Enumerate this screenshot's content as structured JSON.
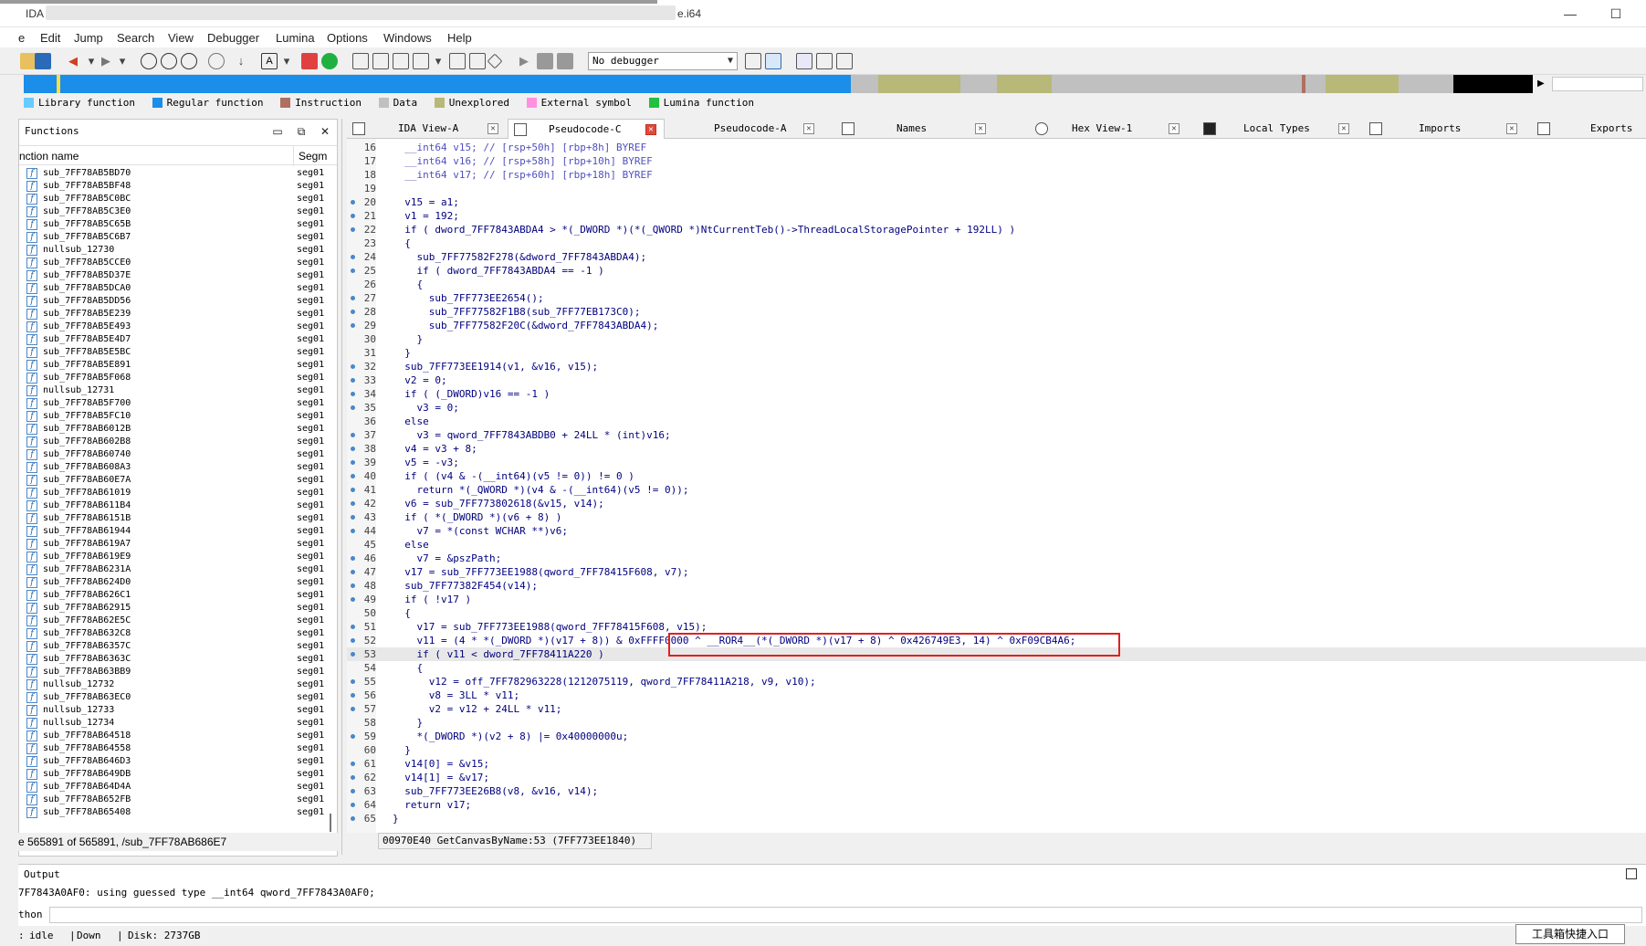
{
  "window": {
    "title_prefix": "IDA -",
    "title_suffix": "e.i64",
    "minimize": "—",
    "maximize": "☐"
  },
  "menu": [
    "e",
    "Edit",
    "Jump",
    "Search",
    "View",
    "Debugger",
    "Lumina",
    "Options",
    "Windows",
    "Help"
  ],
  "toolbar": {
    "debugger_select": "No debugger"
  },
  "legend": [
    {
      "label": "Library function",
      "color": "#66ccff"
    },
    {
      "label": "Regular function",
      "color": "#1a8ee8"
    },
    {
      "label": "Instruction",
      "color": "#b07060"
    },
    {
      "label": "Data",
      "color": "#c0c0c0"
    },
    {
      "label": "Unexplored",
      "color": "#b8b878"
    },
    {
      "label": "External symbol",
      "color": "#ff90e0"
    },
    {
      "label": "Lumina function",
      "color": "#20c040"
    }
  ],
  "functions_panel": {
    "title": "Functions",
    "col_name": "nction name",
    "col_seg": "Segm",
    "items": [
      {
        "name": "sub_7FF78AB5BD70",
        "seg": "seg01"
      },
      {
        "name": "sub_7FF78AB5BF48",
        "seg": "seg01"
      },
      {
        "name": "sub_7FF78AB5C0BC",
        "seg": "seg01"
      },
      {
        "name": "sub_7FF78AB5C3E0",
        "seg": "seg01"
      },
      {
        "name": "sub_7FF78AB5C65B",
        "seg": "seg01"
      },
      {
        "name": "sub_7FF78AB5C6B7",
        "seg": "seg01"
      },
      {
        "name": "nullsub_12730",
        "seg": "seg01"
      },
      {
        "name": "sub_7FF78AB5CCE0",
        "seg": "seg01"
      },
      {
        "name": "sub_7FF78AB5D37E",
        "seg": "seg01"
      },
      {
        "name": "sub_7FF78AB5DCA0",
        "seg": "seg01"
      },
      {
        "name": "sub_7FF78AB5DD56",
        "seg": "seg01"
      },
      {
        "name": "sub_7FF78AB5E239",
        "seg": "seg01"
      },
      {
        "name": "sub_7FF78AB5E493",
        "seg": "seg01"
      },
      {
        "name": "sub_7FF78AB5E4D7",
        "seg": "seg01"
      },
      {
        "name": "sub_7FF78AB5E5BC",
        "seg": "seg01"
      },
      {
        "name": "sub_7FF78AB5E891",
        "seg": "seg01"
      },
      {
        "name": "sub_7FF78AB5F068",
        "seg": "seg01"
      },
      {
        "name": "nullsub_12731",
        "seg": "seg01"
      },
      {
        "name": "sub_7FF78AB5F700",
        "seg": "seg01"
      },
      {
        "name": "sub_7FF78AB5FC10",
        "seg": "seg01"
      },
      {
        "name": "sub_7FF78AB6012B",
        "seg": "seg01"
      },
      {
        "name": "sub_7FF78AB602B8",
        "seg": "seg01"
      },
      {
        "name": "sub_7FF78AB60740",
        "seg": "seg01"
      },
      {
        "name": "sub_7FF78AB608A3",
        "seg": "seg01"
      },
      {
        "name": "sub_7FF78AB60E7A",
        "seg": "seg01"
      },
      {
        "name": "sub_7FF78AB61019",
        "seg": "seg01"
      },
      {
        "name": "sub_7FF78AB611B4",
        "seg": "seg01"
      },
      {
        "name": "sub_7FF78AB6151B",
        "seg": "seg01"
      },
      {
        "name": "sub_7FF78AB61944",
        "seg": "seg01"
      },
      {
        "name": "sub_7FF78AB619A7",
        "seg": "seg01"
      },
      {
        "name": "sub_7FF78AB619E9",
        "seg": "seg01"
      },
      {
        "name": "sub_7FF78AB6231A",
        "seg": "seg01"
      },
      {
        "name": "sub_7FF78AB624D0",
        "seg": "seg01"
      },
      {
        "name": "sub_7FF78AB626C1",
        "seg": "seg01"
      },
      {
        "name": "sub_7FF78AB62915",
        "seg": "seg01"
      },
      {
        "name": "sub_7FF78AB62E5C",
        "seg": "seg01"
      },
      {
        "name": "sub_7FF78AB632C8",
        "seg": "seg01"
      },
      {
        "name": "sub_7FF78AB6357C",
        "seg": "seg01"
      },
      {
        "name": "sub_7FF78AB6363C",
        "seg": "seg01"
      },
      {
        "name": "sub_7FF78AB63BB9",
        "seg": "seg01"
      },
      {
        "name": "nullsub_12732",
        "seg": "seg01"
      },
      {
        "name": "sub_7FF78AB63EC0",
        "seg": "seg01"
      },
      {
        "name": "nullsub_12733",
        "seg": "seg01"
      },
      {
        "name": "nullsub_12734",
        "seg": "seg01"
      },
      {
        "name": "sub_7FF78AB64518",
        "seg": "seg01"
      },
      {
        "name": "sub_7FF78AB64558",
        "seg": "seg01"
      },
      {
        "name": "sub_7FF78AB646D3",
        "seg": "seg01"
      },
      {
        "name": "sub_7FF78AB649DB",
        "seg": "seg01"
      },
      {
        "name": "sub_7FF78AB64D4A",
        "seg": "seg01"
      },
      {
        "name": "sub_7FF78AB652FB",
        "seg": "seg01"
      },
      {
        "name": "sub_7FF78AB65408",
        "seg": "seg01"
      }
    ],
    "status": "e 565891 of 565891, /sub_7FF78AB686E7"
  },
  "tabs": [
    {
      "label": "IDA View-A",
      "active": false
    },
    {
      "label": "Pseudocode-C",
      "active": true
    },
    {
      "label": "Pseudocode-A",
      "active": false
    },
    {
      "label": "Names",
      "active": false
    },
    {
      "label": "Hex View-1",
      "active": false
    },
    {
      "label": "Local Types",
      "active": false
    },
    {
      "label": "Imports",
      "active": false
    },
    {
      "label": "Exports",
      "active": false
    }
  ],
  "code": [
    {
      "n": "16",
      "dot": false,
      "t": "  __int64 v15; // [rsp+50h] [rbp+8h] BYREF"
    },
    {
      "n": "17",
      "dot": false,
      "t": "  __int64 v16; // [rsp+58h] [rbp+10h] BYREF"
    },
    {
      "n": "18",
      "dot": false,
      "t": "  __int64 v17; // [rsp+60h] [rbp+18h] BYREF"
    },
    {
      "n": "19",
      "dot": false,
      "t": ""
    },
    {
      "n": "20",
      "dot": true,
      "t": "  v15 = a1;"
    },
    {
      "n": "21",
      "dot": true,
      "t": "  v1 = 192;"
    },
    {
      "n": "22",
      "dot": true,
      "t": "  if ( dword_7FF7843ABDA4 > *(_DWORD *)(*(_QWORD *)NtCurrentTeb()->ThreadLocalStoragePointer + 192LL) )"
    },
    {
      "n": "23",
      "dot": false,
      "t": "  {"
    },
    {
      "n": "24",
      "dot": true,
      "t": "    sub_7FF77582F278(&dword_7FF7843ABDA4);"
    },
    {
      "n": "25",
      "dot": true,
      "t": "    if ( dword_7FF7843ABDA4 == -1 )"
    },
    {
      "n": "26",
      "dot": false,
      "t": "    {"
    },
    {
      "n": "27",
      "dot": true,
      "t": "      sub_7FF773EE2654();"
    },
    {
      "n": "28",
      "dot": true,
      "t": "      sub_7FF77582F1B8(sub_7FF77EB173C0);"
    },
    {
      "n": "29",
      "dot": true,
      "t": "      sub_7FF77582F20C(&dword_7FF7843ABDA4);"
    },
    {
      "n": "30",
      "dot": false,
      "t": "    }"
    },
    {
      "n": "31",
      "dot": false,
      "t": "  }"
    },
    {
      "n": "32",
      "dot": true,
      "t": "  sub_7FF773EE1914(v1, &v16, v15);"
    },
    {
      "n": "33",
      "dot": true,
      "t": "  v2 = 0;"
    },
    {
      "n": "34",
      "dot": true,
      "t": "  if ( (_DWORD)v16 == -1 )"
    },
    {
      "n": "35",
      "dot": true,
      "t": "    v3 = 0;"
    },
    {
      "n": "36",
      "dot": false,
      "t": "  else"
    },
    {
      "n": "37",
      "dot": true,
      "t": "    v3 = qword_7FF7843ABDB0 + 24LL * (int)v16;"
    },
    {
      "n": "38",
      "dot": true,
      "t": "  v4 = v3 + 8;"
    },
    {
      "n": "39",
      "dot": true,
      "t": "  v5 = -v3;"
    },
    {
      "n": "40",
      "dot": true,
      "t": "  if ( (v4 & -(__int64)(v5 != 0)) != 0 )"
    },
    {
      "n": "41",
      "dot": true,
      "t": "    return *(_QWORD *)(v4 & -(__int64)(v5 != 0));"
    },
    {
      "n": "42",
      "dot": true,
      "t": "  v6 = sub_7FF773802618(&v15, v14);"
    },
    {
      "n": "43",
      "dot": true,
      "t": "  if ( *(_DWORD *)(v6 + 8) )"
    },
    {
      "n": "44",
      "dot": true,
      "t": "    v7 = *(const WCHAR **)v6;"
    },
    {
      "n": "45",
      "dot": false,
      "t": "  else"
    },
    {
      "n": "46",
      "dot": true,
      "t": "    v7 = &pszPath;"
    },
    {
      "n": "47",
      "dot": true,
      "t": "  v17 = sub_7FF773EE1988(qword_7FF78415F608, v7);"
    },
    {
      "n": "48",
      "dot": true,
      "t": "  sub_7FF77382F454(v14);"
    },
    {
      "n": "49",
      "dot": true,
      "t": "  if ( !v17 )"
    },
    {
      "n": "50",
      "dot": false,
      "t": "  {"
    },
    {
      "n": "51",
      "dot": true,
      "t": "    v17 = sub_7FF773EE1988(qword_7FF78415F608, v15);"
    },
    {
      "n": "52",
      "dot": true,
      "t": "    v11 = (4 * *(_DWORD *)(v17 + 8)) & 0xFFFF0000 ^ __ROR4__(*(_DWORD *)(v17 + 8) ^ 0x426749E3, 14) ^ 0xF09CB4A6;"
    },
    {
      "n": "53",
      "dot": true,
      "t": "    if ( v11 < dword_7FF78411A220 )",
      "hl": true
    },
    {
      "n": "54",
      "dot": false,
      "t": "    {"
    },
    {
      "n": "55",
      "dot": true,
      "t": "      v12 = off_7FF782963228(1212075119, qword_7FF78411A218, v9, v10);"
    },
    {
      "n": "56",
      "dot": true,
      "t": "      v8 = 3LL * v11;"
    },
    {
      "n": "57",
      "dot": true,
      "t": "      v2 = v12 + 24LL * v11;"
    },
    {
      "n": "58",
      "dot": false,
      "t": "    }"
    },
    {
      "n": "59",
      "dot": true,
      "t": "    *(_DWORD *)(v2 + 8) |= 0x40000000u;"
    },
    {
      "n": "60",
      "dot": false,
      "t": "  }"
    },
    {
      "n": "61",
      "dot": true,
      "t": "  v14[0] = &v15;"
    },
    {
      "n": "62",
      "dot": true,
      "t": "  v14[1] = &v17;"
    },
    {
      "n": "63",
      "dot": true,
      "t": "  sub_7FF773EE26B8(v8, &v16, v14);"
    },
    {
      "n": "64",
      "dot": true,
      "t": "  return v17;"
    },
    {
      "n": "65",
      "dot": true,
      "t": "}"
    }
  ],
  "code_status": "00970E40 GetCanvasByName:53 (7FF773EE1840)",
  "output": {
    "title": "Output",
    "text": "7F7843A0AF0: using guessed type __int64 qword_7FF7843A0AF0;",
    "lang": "thon"
  },
  "statusbar": {
    "state": "idle",
    "direction": "Down",
    "disk": "Disk: 2737GB"
  },
  "ime_tip": "工具箱快捷入口"
}
